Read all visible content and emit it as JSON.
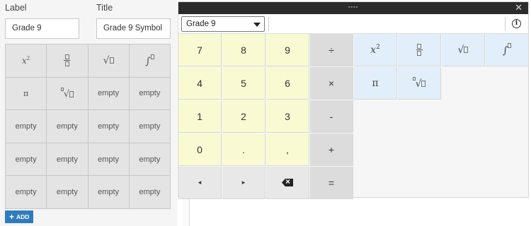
{
  "form": {
    "label_caption": "Label",
    "title_caption": "Title",
    "label_value": "Grade 9",
    "title_value": "Grade 9 Symbol"
  },
  "left_grid": [
    {
      "kind": "xsq"
    },
    {
      "kind": "frac"
    },
    {
      "kind": "sqrt"
    },
    {
      "kind": "integral"
    },
    {
      "kind": "text",
      "text": "π"
    },
    {
      "kind": "nthroot"
    },
    {
      "kind": "text",
      "text": "empty"
    },
    {
      "kind": "text",
      "text": "empty"
    },
    {
      "kind": "text",
      "text": "empty"
    },
    {
      "kind": "text",
      "text": "empty"
    },
    {
      "kind": "text",
      "text": "empty"
    },
    {
      "kind": "text",
      "text": "empty"
    },
    {
      "kind": "text",
      "text": "empty"
    },
    {
      "kind": "text",
      "text": "empty"
    },
    {
      "kind": "text",
      "text": "empty"
    },
    {
      "kind": "text",
      "text": "empty"
    },
    {
      "kind": "text",
      "text": "empty"
    },
    {
      "kind": "text",
      "text": "empty"
    },
    {
      "kind": "text",
      "text": "empty"
    },
    {
      "kind": "text",
      "text": "empty"
    }
  ],
  "add_button": {
    "label": "ADD",
    "icon": "plus-icon"
  },
  "keyboard": {
    "close_glyph": "✕",
    "selected_grade": "Grade 9",
    "info_glyph": "i",
    "keys": {
      "k7": "7",
      "k8": "8",
      "k9": "9",
      "div": "÷",
      "k4": "4",
      "k5": "5",
      "k6": "6",
      "mul": "×",
      "k1": "1",
      "k2": "2",
      "k3": "3",
      "minus": "-",
      "k0": "0",
      "dot": ".",
      "comma": ",",
      "plus": "+",
      "left": "◂",
      "right": "▸",
      "equals": "=",
      "pi": "π"
    }
  }
}
